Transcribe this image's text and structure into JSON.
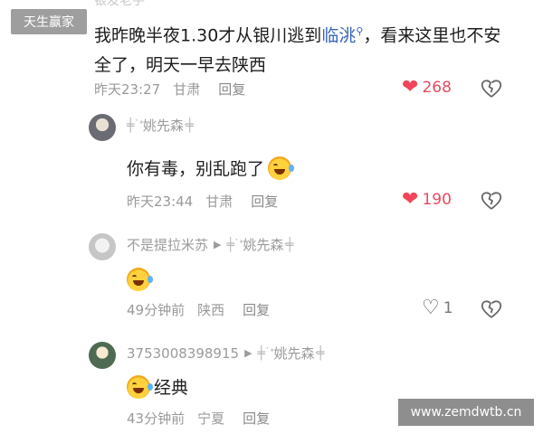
{
  "watermarks": {
    "top_left": "天生赢家",
    "bottom_right": "www.zemdwtb.cn"
  },
  "top_cut_text": "银发老手",
  "comment1": {
    "text_part1": "我昨晚半夜1.30才从银川逃到",
    "link": "临洮",
    "text_part2": "，看来这里也不安全了，明天一早去陕西",
    "time": "昨天23:27",
    "location": "甘肃",
    "reply": "回复",
    "likes": "268"
  },
  "reply1": {
    "user": "姚先森",
    "text": "你有毒，别乱跑了",
    "time": "昨天23:44",
    "location": "甘肃",
    "reply": "回复",
    "likes": "190"
  },
  "reply2": {
    "user": "不是提拉米苏",
    "to_user": "姚先森",
    "time": "49分钟前",
    "location": "陕西",
    "reply": "回复",
    "likes": "1"
  },
  "reply3": {
    "user": "3753008398915",
    "to_user": "姚先森",
    "text": "经典",
    "time": "43分钟前",
    "location": "宁夏",
    "reply": "回复"
  },
  "icons": {
    "like_filled": "heart-filled-icon",
    "like_outline": "heart-outline-icon",
    "dislike": "broken-heart-icon",
    "search": "search-icon",
    "emoji": "laughing-tears-emoji",
    "arrow": "reply-arrow-icon"
  },
  "colors": {
    "like_red": "#f0455a",
    "link_blue": "#3a66b8",
    "meta_gray": "#9a9a9a"
  }
}
